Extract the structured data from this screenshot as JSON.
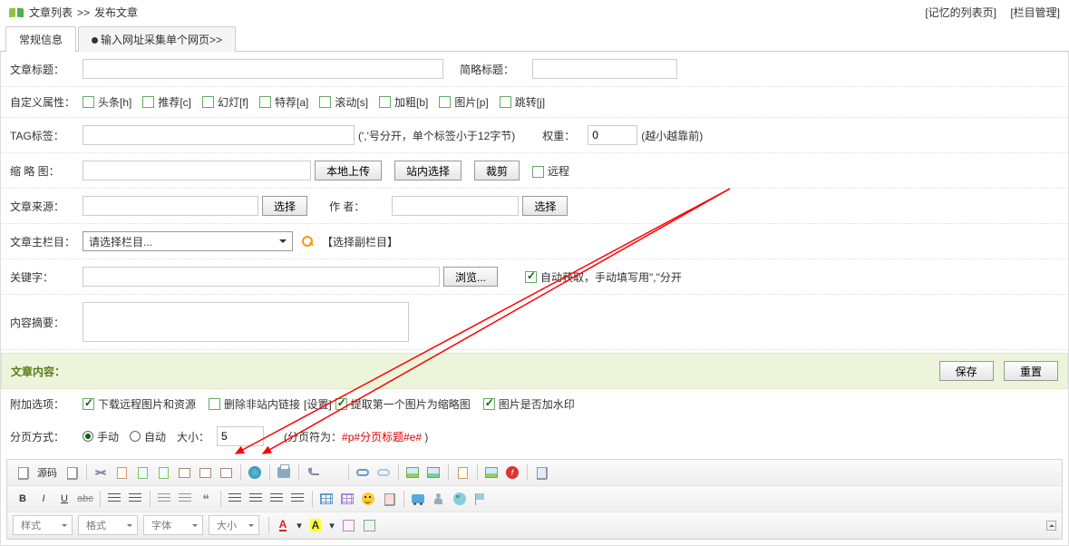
{
  "breadcrumb": {
    "list": "文章列表",
    "sep": ">>",
    "publish": "发布文章",
    "mem_link": "[记忆的列表页]",
    "cat_link": "[栏目管理]"
  },
  "tabs": {
    "t1": "常规信息",
    "t2": "输入网址采集单个网页>>"
  },
  "labels": {
    "title": "文章标题：",
    "short": "简略标题：",
    "attrs": "自定义属性：",
    "tag": "TAG标签：",
    "tag_hint": "(','号分开，单个标签小于12字节)",
    "weight": "权重：",
    "weight_hint": "(越小越靠前)",
    "thumb": "缩 略 图：",
    "source": "文章来源：",
    "author": "作 者：",
    "main_cat": "文章主栏目：",
    "sub_cat": "【选择副栏目】",
    "keywords": "关键字：",
    "kw_hint": "自动获取，手动填写用\",\"分开",
    "summary": "内容摘要：",
    "content": "文章内容：",
    "extra": "附加选项：",
    "paging": "分页方式：",
    "size": "大小：",
    "page_hint1": "(分页符为：",
    "page_hint2": "#p#分页标题#e#",
    "page_hint3": " )"
  },
  "attrs": {
    "h": "头条[h]",
    "c": "推荐[c]",
    "f": "幻灯[f]",
    "a": "特荐[a]",
    "s": "滚动[s]",
    "b": "加粗[b]",
    "p": "图片[p]",
    "j": "跳转[j]"
  },
  "buttons": {
    "upload": "本地上传",
    "pick_site": "站内选择",
    "crop": "裁剪",
    "remote": "远程",
    "select": "选择",
    "browse": "浏览...",
    "save": "保存",
    "reset": "重置"
  },
  "values": {
    "weight": "0",
    "main_cat": "请选择栏目...",
    "page_size": "5"
  },
  "extras": {
    "dl": "下载远程图片和资源",
    "rm": "删除非站内链接",
    "set": "[设置]",
    "first": "提取第一个图片为缩略图",
    "wm": "图片是否加水印"
  },
  "paging": {
    "manual": "手动",
    "auto": "自动"
  },
  "editor": {
    "source": "源码",
    "style": "样式",
    "format": "格式",
    "font": "字体",
    "size": "大小",
    "bold": "B",
    "italic": "I",
    "underline": "U",
    "strike": "abc",
    "flash_f": "f"
  }
}
